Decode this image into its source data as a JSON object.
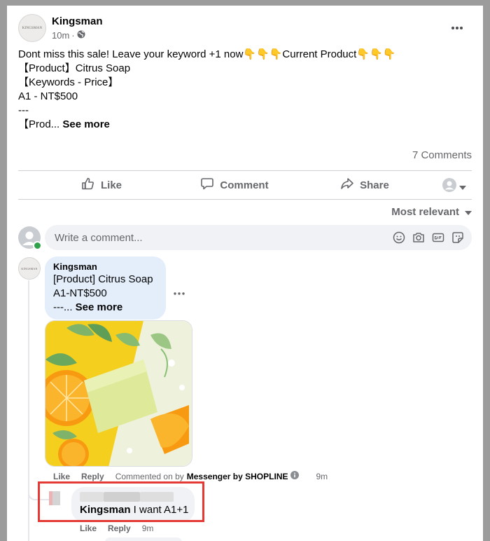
{
  "post": {
    "page_name": "Kingsman",
    "logo_text": "KINGSMAN",
    "timestamp": "10m",
    "separator": "·",
    "body": "Dont miss this sale! Leave your keyword +1 now👇👇👇Current Product👇👇👇\n【Product】Citrus Soap\n【Keywords - Price】\nA1 - NT$500\n---\n【Prod... ",
    "see_more": "See more",
    "comments_count": "7 Comments"
  },
  "actions": {
    "like": "Like",
    "comment": "Comment",
    "share": "Share"
  },
  "sort_label": "Most relevant",
  "comment_box": {
    "placeholder": "Write a comment..."
  },
  "comment1": {
    "author": "Kingsman",
    "logo_text": "KINGSMAN",
    "text": "[Product] Citrus Soap\nA1-NT$500\n---... ",
    "see_more": "See more",
    "like": "Like",
    "reply": "Reply",
    "source_prefix": "Commented on by",
    "source_app": "Messenger by SHOPLINE",
    "time": "9m"
  },
  "reply1": {
    "mention": "Kingsman",
    "text": " I want A1+1",
    "like": "Like",
    "reply": "Reply",
    "time": "9m"
  },
  "colors": {
    "link_blue": "#1877f2",
    "highlight_red": "#e53935",
    "bubble_blue": "#e4eefb",
    "bubble_gray": "#f0f2f5",
    "online_green": "#31a24c"
  },
  "icons": [
    "globe-icon",
    "more-options-icon",
    "like-icon",
    "comment-icon",
    "share-icon",
    "dropdown-icon",
    "emoji-icon",
    "camera-icon",
    "gif-icon",
    "sticker-icon",
    "info-icon"
  ]
}
